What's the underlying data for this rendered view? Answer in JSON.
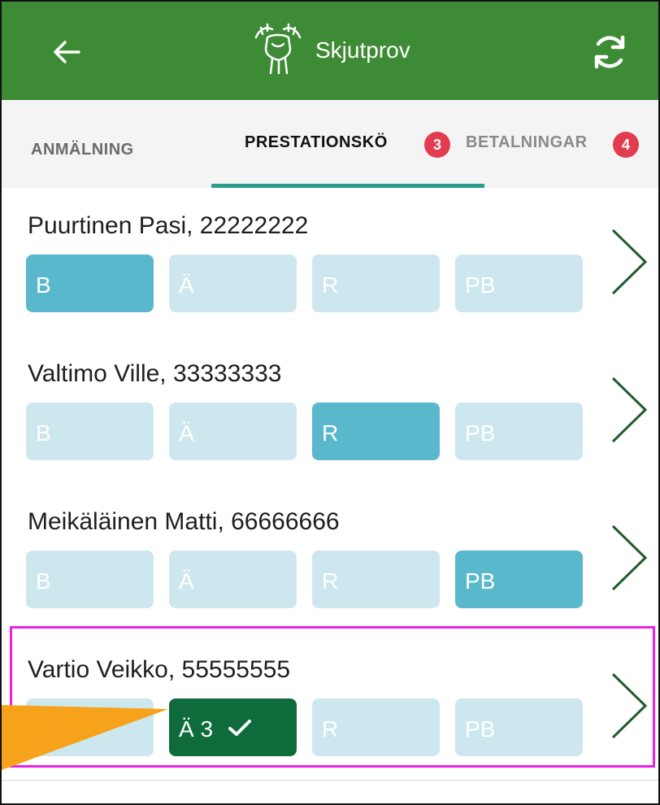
{
  "appbar": {
    "title": "Skjutprov",
    "back_icon": "arrow-left-icon",
    "logo_icon": "moose-logo-icon",
    "refresh_icon": "refresh-icon",
    "background": "#3d8b34"
  },
  "tabs": [
    {
      "label": "ANMÄLNING",
      "selected": false
    },
    {
      "label": "PRESTATIONSKÖ",
      "selected": true,
      "badge": "3"
    },
    {
      "label": "BETALNINGAR",
      "selected": false,
      "badge": "4"
    }
  ],
  "rows": [
    {
      "name": "Puurtinen Pasi, 22222222",
      "pills": [
        "B",
        "Ä",
        "R",
        "PB"
      ]
    },
    {
      "name": "Valtimo Ville, 33333333",
      "pills": [
        "B",
        "Ä",
        "R",
        "PB"
      ]
    },
    {
      "name": "Meikäläinen Matti, 66666666",
      "pills": [
        "B",
        "Ä",
        "R",
        "PB"
      ]
    },
    {
      "name": "Vartio Veikko, 55555555",
      "pills": [
        "B",
        "Ä 3",
        "R",
        "PB"
      ],
      "check_icon": "checkmark-icon"
    }
  ],
  "colors": {
    "pill_inactive": "#cde7ee",
    "pill_active": "#5ab8cc",
    "pill_done": "#0f6b3c",
    "badge": "#e33b4f",
    "tab_indicator": "#2a9d8f",
    "highlight": "#ee20e8",
    "arrow": "#f7a21b"
  }
}
